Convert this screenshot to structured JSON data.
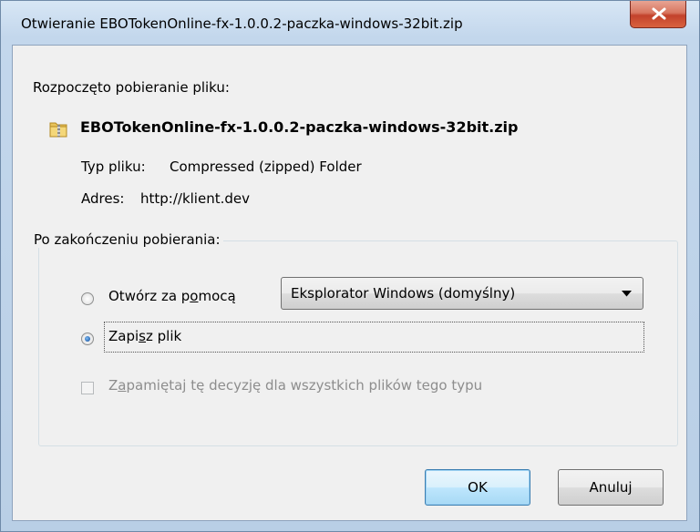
{
  "window": {
    "title": "Otwieranie EBOTokenOnline-fx-1.0.0.2-paczka-windows-32bit.zip",
    "close_icon": "close-icon"
  },
  "download": {
    "started_text": "Rozpoczęto pobieranie pliku:",
    "file_icon": "zip-folder-icon",
    "filename": "EBOTokenOnline-fx-1.0.0.2-paczka-windows-32bit.zip",
    "type_label": "Typ pliku:",
    "type_value": "Compressed (zipped) Folder",
    "address_label": "Adres:",
    "address_value": "http://klient.dev"
  },
  "after_download": {
    "legend": "Po zakończeniu pobierania:",
    "open_with_label_pre": "Otwórz za p",
    "open_with_label_accel": "o",
    "open_with_label_post": "mocą",
    "open_with_selected": false,
    "open_with_app": "Eksplorator Windows (domyślny)",
    "save_label_pre": "Zapi",
    "save_label_accel": "s",
    "save_label_post": "z plik",
    "save_selected": true,
    "remember_label_pre": "Z",
    "remember_label_accel": "a",
    "remember_label_post": "pamiętaj tę decyzję dla wszystkich plików tego typu",
    "remember_checked": false,
    "remember_enabled": false
  },
  "buttons": {
    "ok": "OK",
    "cancel": "Anuluj"
  },
  "colors": {
    "title_bar": "#c3d7ec",
    "close_button": "#c2422b",
    "dialog_bg": "#f0f0f0",
    "default_button_border": "#3c7fb1"
  }
}
